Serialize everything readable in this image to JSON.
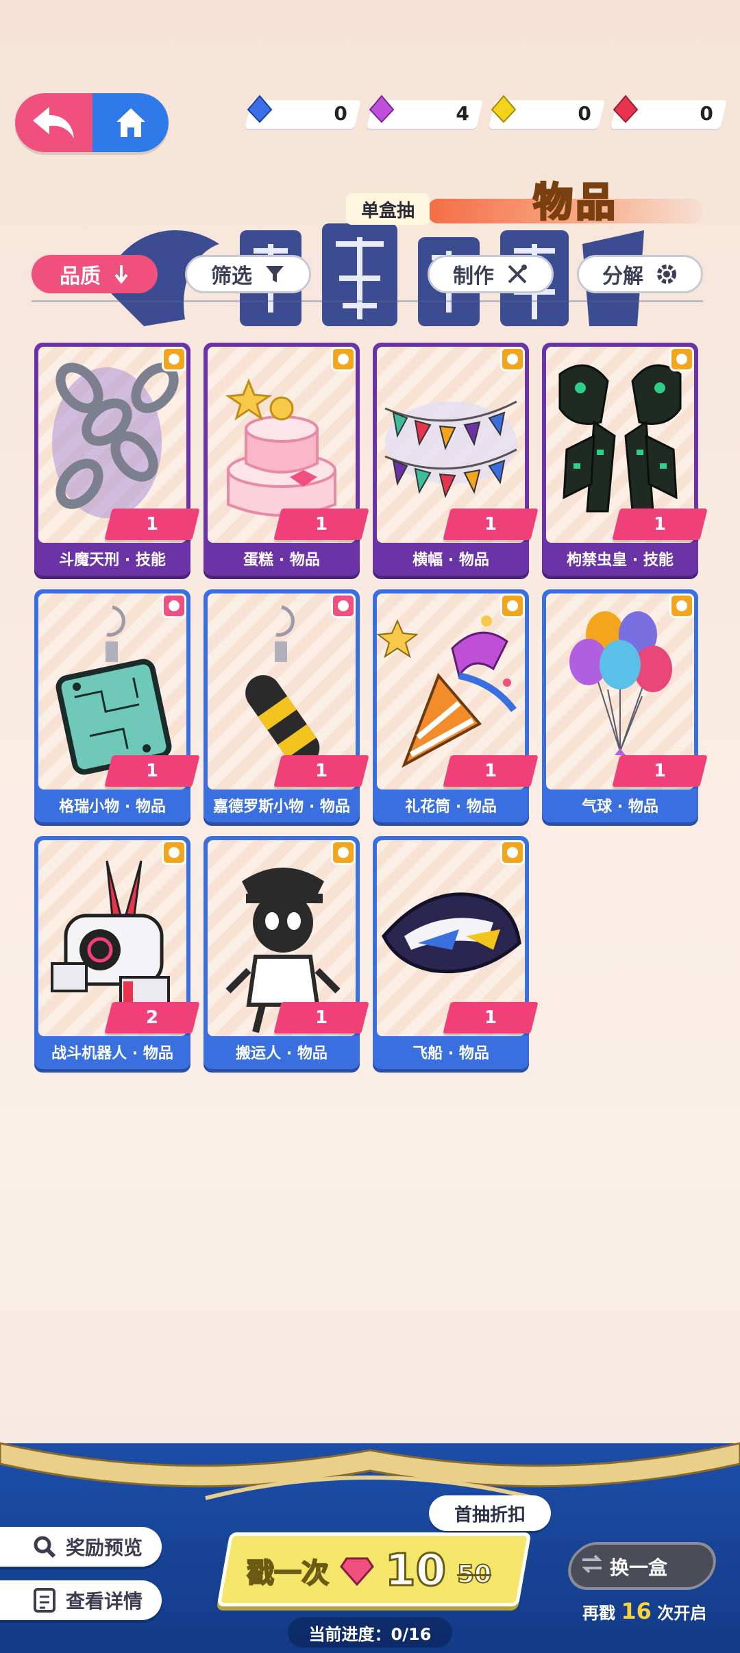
{
  "nav": {
    "back_icon": "back-arrow-icon",
    "home_icon": "home-icon"
  },
  "currencies": [
    {
      "icon": "blue-gem-icon",
      "color": "#3b6fe8",
      "value": "0"
    },
    {
      "icon": "purple-gem-icon",
      "color": "#c04fd8",
      "value": "4"
    },
    {
      "icon": "yellow-gem-icon",
      "color": "#f2d21d",
      "value": "0"
    },
    {
      "icon": "red-gem-icon",
      "color": "#e8354f",
      "value": "0"
    }
  ],
  "banner": {
    "box_label": "单盒抽",
    "category_title": "物品"
  },
  "filters": {
    "quality": {
      "label": "品质",
      "icon": "down-arrow-icon"
    },
    "filter": {
      "label": "筛选",
      "icon": "funnel-icon"
    },
    "craft": {
      "label": "制作",
      "icon": "tools-icon"
    },
    "decompose": {
      "label": "分解",
      "icon": "gear-icon"
    }
  },
  "items": [
    {
      "name": "斗魔天刑 · 技能",
      "count": "1",
      "rarity": "purple",
      "art": "chains-icon"
    },
    {
      "name": "蛋糕 · 物品",
      "count": "1",
      "rarity": "purple",
      "art": "cake-icon"
    },
    {
      "name": "横幅 · 物品",
      "count": "1",
      "rarity": "purple",
      "art": "bunting-icon"
    },
    {
      "name": "枸禁虫皇 · 技能",
      "count": "1",
      "rarity": "purple",
      "art": "insect-claws-icon"
    },
    {
      "name": "格瑞小物 · 物品",
      "count": "1",
      "rarity": "blue",
      "art": "circuit-keychain-icon"
    },
    {
      "name": "嘉德罗斯小物 · 物品",
      "count": "1",
      "rarity": "blue",
      "art": "stick-keychain-icon"
    },
    {
      "name": "礼花筒 · 物品",
      "count": "1",
      "rarity": "blue",
      "art": "party-popper-icon"
    },
    {
      "name": "气球 · 物品",
      "count": "1",
      "rarity": "blue",
      "art": "balloons-icon"
    },
    {
      "name": "战斗机器人 · 物品",
      "count": "2",
      "rarity": "blue",
      "art": "battle-robot-icon"
    },
    {
      "name": "搬运人 · 物品",
      "count": "1",
      "rarity": "blue",
      "art": "porter-icon"
    },
    {
      "name": "飞船 · 物品",
      "count": "1",
      "rarity": "blue",
      "art": "spaceship-icon"
    }
  ],
  "bottom": {
    "reward_preview": "奖励预览",
    "view_details": "查看详情",
    "draw_label": "戳一次",
    "draw_price": "10",
    "draw_price_old": "50",
    "discount_tag": "首抽折扣",
    "swap_label": "换一盒",
    "swap_prefix": "再戳",
    "swap_count": "16",
    "swap_suffix": "次开启",
    "progress": "当前进度：0/16"
  }
}
